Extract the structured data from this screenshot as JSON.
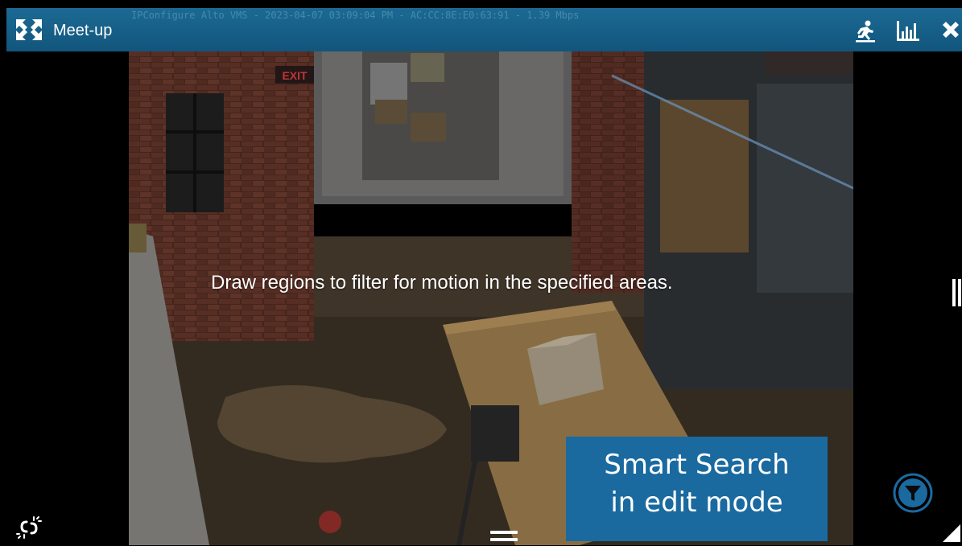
{
  "camera": {
    "title": "Meet-up",
    "overlay_text": "IPConfigure Alto VMS - 2023-04-07 03:09:04 PM - AC:CC:8E:E0:63:91 - 1.39 Mbps",
    "exit_sign": "EXIT"
  },
  "toolbar": {
    "expand_icon": "expand-arrows-icon",
    "motion_icon": "running-figure-icon",
    "stats_icon": "bar-chart-icon",
    "close_icon": "close-icon"
  },
  "video": {
    "message": "Draw regions to filter for motion in the specified areas."
  },
  "callout": {
    "line1": "Smart Search",
    "line2": "in edit mode"
  },
  "controls": {
    "filter_icon": "filter-funnel-icon",
    "unlink_icon": "broken-link-icon",
    "menu_icon": "hamburger-icon",
    "resize_icon": "resize-corner-icon"
  },
  "colors": {
    "titlebar": "#15608a",
    "callout": "#1a6aa0",
    "filter_ring": "#1a6aa0"
  }
}
